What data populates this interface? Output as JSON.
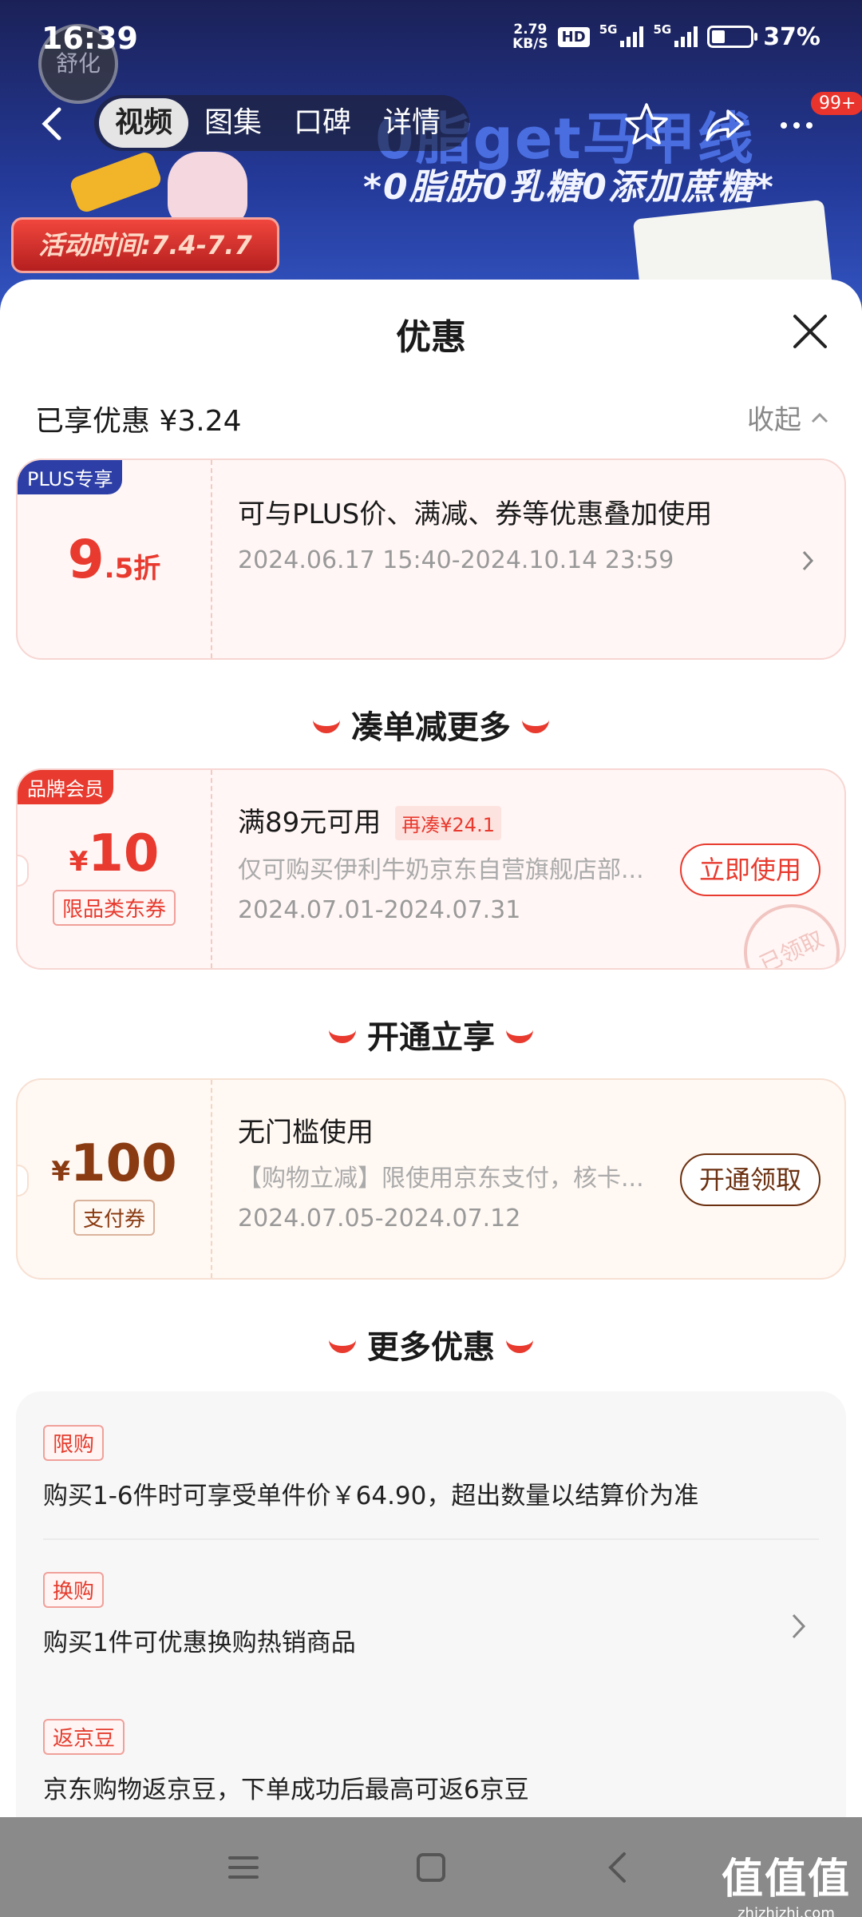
{
  "status_bar": {
    "time": "16:39",
    "speed_value": "2.79",
    "speed_unit": "KB/S",
    "hd_label": "HD",
    "net1": "5G",
    "net2": "5G",
    "battery": "37%"
  },
  "banner": {
    "logo_text": "舒化",
    "headline": "0脂get马甲线",
    "subline": "*0脂肪0乳糖0添加蔗糖*",
    "event_time": "活动时间:7.4-7.7"
  },
  "nav": {
    "tabs": [
      {
        "label": "视频",
        "active": true
      },
      {
        "label": "图集"
      },
      {
        "label": "口碑"
      },
      {
        "label": "详情"
      }
    ],
    "badge": "99+"
  },
  "sheet": {
    "title": "优惠",
    "saved_label": "已享优惠 ¥3.24",
    "collapse_label": "收起"
  },
  "plus_card": {
    "tag": "PLUS专享",
    "discount_big": "9",
    "discount_small": ".5折",
    "title": "可与PLUS价、满减、券等优惠叠加使用",
    "date": "2024.06.17 15:40-2024.10.14 23:59"
  },
  "section1": "凑单减更多",
  "coupon_card": {
    "tag": "品牌会员",
    "currency": "¥",
    "amount": "10",
    "type_label": "限品类东券",
    "title": "满89元可用",
    "hint": "再凑¥24.1",
    "desc": "仅可购买伊利牛奶京东自营旗舰店部...",
    "date": "2024.07.01-2024.07.31",
    "button": "立即使用",
    "stamp": "已领取"
  },
  "section2": "开通立享",
  "pay_card": {
    "currency": "¥",
    "amount": "100",
    "type_label": "支付券",
    "title": "无门槛使用",
    "desc": "【购物立减】限使用京东支付，核卡...",
    "date": "2024.07.05-2024.07.12",
    "button": "开通领取"
  },
  "section3": "更多优惠",
  "more": [
    {
      "label": "限购",
      "text": "购买1-6件时可享受单件价￥64.90，超出数量以结算价为准"
    },
    {
      "label": "换购",
      "text": "购买1件可优惠换购热销商品"
    },
    {
      "label": "返京豆",
      "text": "京东购物返京豆，下单成功后最高可返6京豆"
    }
  ],
  "watermark": {
    "main": "值值值",
    "sub": "zhizhizhi.com"
  },
  "colors": {
    "accent_red": "#e83a2e",
    "plus_blue": "#2d3fa6",
    "sheet_bg": "#ffffff"
  }
}
